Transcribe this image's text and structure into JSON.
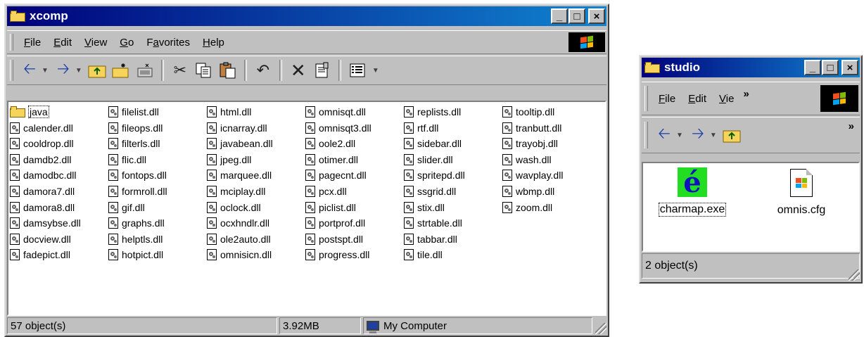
{
  "xcomp": {
    "title": "xcomp",
    "title_buttons": [
      "_",
      "□",
      "×"
    ],
    "menu": [
      {
        "label": "File",
        "u": "F",
        "rest": "ile"
      },
      {
        "label": "Edit",
        "u": "E",
        "rest": "dit"
      },
      {
        "label": "View",
        "u": "V",
        "rest": "iew"
      },
      {
        "label": "Go",
        "u": "G",
        "rest": "o"
      },
      {
        "label": "Favorites",
        "u": "a",
        "pre": "F",
        "rest": "vorites"
      },
      {
        "label": "Help",
        "u": "H",
        "rest": "elp"
      }
    ],
    "columns": [
      [
        "java",
        "calender.dll",
        "cooldrop.dll",
        "damdb2.dll",
        "damodbc.dll",
        "damora7.dll",
        "damora8.dll",
        "damsybse.dll",
        "docview.dll",
        "fadepict.dll"
      ],
      [
        "filelist.dll",
        "fileops.dll",
        "filterls.dll",
        "flic.dll",
        "fontops.dll",
        "formroll.dll",
        "gif.dll",
        "graphs.dll",
        "helptls.dll",
        "hotpict.dll"
      ],
      [
        "html.dll",
        "icnarray.dll",
        "javabean.dll",
        "jpeg.dll",
        "marquee.dll",
        "mciplay.dll",
        "oclock.dll",
        "ocxhndlr.dll",
        "ole2auto.dll",
        "omnisicn.dll"
      ],
      [
        "omnisqt.dll",
        "omnisqt3.dll",
        "oole2.dll",
        "otimer.dll",
        "pagecnt.dll",
        "pcx.dll",
        "piclist.dll",
        "portprof.dll",
        "postspt.dll",
        "progress.dll"
      ],
      [
        "replists.dll",
        "rtf.dll",
        "sidebar.dll",
        "slider.dll",
        "spritepd.dll",
        "ssgrid.dll",
        "stix.dll",
        "strtable.dll",
        "tabbar.dll",
        "tile.dll"
      ],
      [
        "tooltip.dll",
        "tranbutt.dll",
        "trayobj.dll",
        "wash.dll",
        "wavplay.dll",
        "wbmp.dll",
        "zoom.dll"
      ]
    ],
    "status": {
      "objects": "57 object(s)",
      "size": "3.92MB",
      "location": "My Computer"
    }
  },
  "studio": {
    "title": "studio",
    "title_buttons": [
      "_",
      "□",
      "×"
    ],
    "menu": [
      {
        "label": "File",
        "u": "F",
        "rest": "ile"
      },
      {
        "label": "Edit",
        "u": "E",
        "rest": "dit"
      },
      {
        "label": "Vie",
        "u": "V",
        "rest": "ie"
      }
    ],
    "menu_more": "»",
    "toolbar_more": "»",
    "icons": [
      {
        "name": "charmap.exe",
        "kind": "app-e-icon"
      },
      {
        "name": "omnis.cfg",
        "kind": "config-file-icon"
      }
    ],
    "status": {
      "objects": "2 object(s)"
    }
  }
}
